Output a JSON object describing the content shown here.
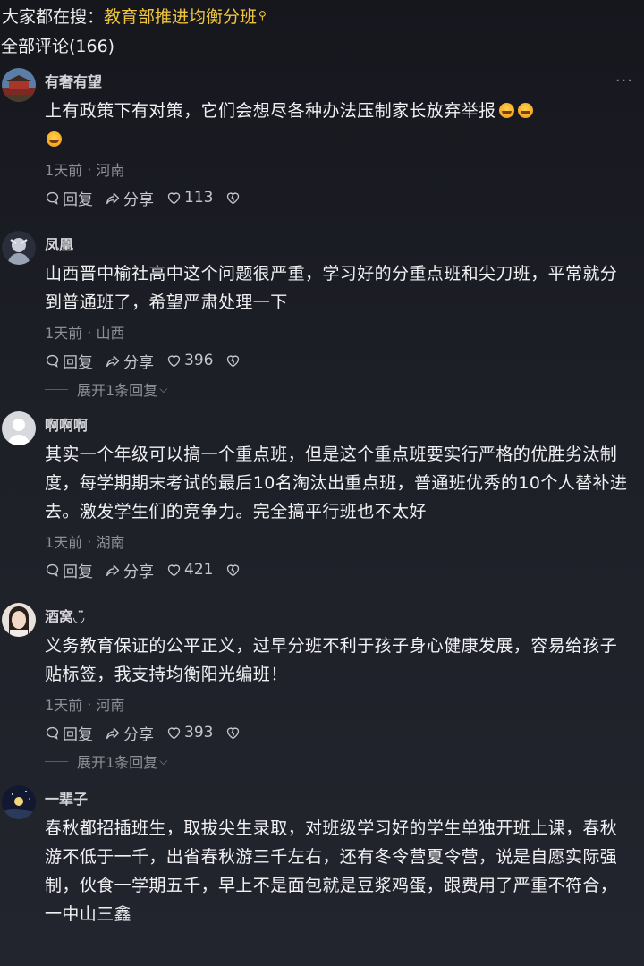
{
  "search": {
    "prefix": "大家都在搜：",
    "link": "教育部推进均衡分班"
  },
  "comments_header": {
    "label": "全部评论(166)"
  },
  "comments": [
    {
      "username": "有奢有望",
      "text": "上有政策下有对策，它们会想尽各种办法压制家长放弃举报",
      "emoji_count": 3,
      "time": "1天前",
      "location": "河南",
      "reply_label": "回复",
      "share_label": "分享",
      "likes": "113"
    },
    {
      "username": "凤凰",
      "text": "山西晋中榆社高中这个问题很严重，学习好的分重点班和尖刀班，平常就分到普通班了，希望严肃处理一下",
      "time": "1天前",
      "location": "山西",
      "reply_label": "回复",
      "share_label": "分享",
      "likes": "396",
      "expand_label": "展开1条回复"
    },
    {
      "username": "啊啊啊",
      "text": "其实一个年级可以搞一个重点班，但是这个重点班要实行严格的优胜劣汰制度，每学期期末考试的最后10名淘汰出重点班，普通班优秀的10个人替补进去。激发学生们的竞争力。完全搞平行班也不太好",
      "time": "1天前",
      "location": "湖南",
      "reply_label": "回复",
      "share_label": "分享",
      "likes": "421"
    },
    {
      "username": "酒窝◡̈",
      "text": "义务教育保证的公平正义，过早分班不利于孩子身心健康发展，容易给孩子贴标签，我支持均衡阳光编班！",
      "time": "1天前",
      "location": "河南",
      "reply_label": "回复",
      "share_label": "分享",
      "likes": "393",
      "expand_label": "展开1条回复"
    },
    {
      "username": "一辈子",
      "text": "春秋都招插班生，取拔尖生录取，对班级学习好的学生单独开班上课，春秋游不低于一千，出省春秋游三千左右，还有冬令营夏令营，说是自愿实际强制，伙食一学期五千，早上不是面包就是豆浆鸡蛋，跟费用了严重不符合，一中山三鑫"
    }
  ],
  "icons": {
    "search_hint": "search-icon",
    "more": "more-dots-icon",
    "reply": "comment-bubble-icon",
    "share": "share-arrow-icon",
    "like": "heart-icon",
    "dislike": "broken-heart-icon",
    "expand": "chevron-down-icon"
  },
  "colors": {
    "search_link": "#f0c53e",
    "background": "#1e2028",
    "muted_text": "#8e8f96"
  }
}
